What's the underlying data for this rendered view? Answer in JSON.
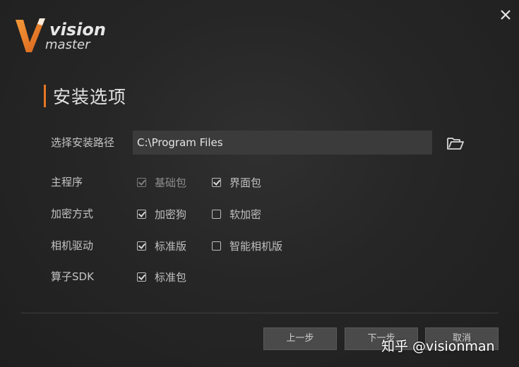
{
  "window": {
    "close_icon": "close-icon"
  },
  "logo": {
    "line1": "vision",
    "line2": "master",
    "accent_color": "#e87722"
  },
  "section": {
    "title": "安装选项"
  },
  "install_path": {
    "label": "选择安装路径",
    "value": "C:\\Program Files",
    "browse_icon": "folder-open-icon"
  },
  "rows": [
    {
      "label": "主程序",
      "options": [
        {
          "label": "基础包",
          "checked": true,
          "disabled": true
        },
        {
          "label": "界面包",
          "checked": true,
          "disabled": false
        }
      ]
    },
    {
      "label": "加密方式",
      "options": [
        {
          "label": "加密狗",
          "checked": true,
          "disabled": false
        },
        {
          "label": "软加密",
          "checked": false,
          "disabled": false
        }
      ]
    },
    {
      "label": "相机驱动",
      "options": [
        {
          "label": "标准版",
          "checked": true,
          "disabled": false
        },
        {
          "label": "智能相机版",
          "checked": false,
          "disabled": false
        }
      ]
    },
    {
      "label": "算子SDK",
      "options": [
        {
          "label": "标准包",
          "checked": true,
          "disabled": false
        }
      ]
    }
  ],
  "buttons": {
    "prev": "上一步",
    "next": "下一步",
    "cancel": "取消"
  },
  "watermark": "知乎 @visionman"
}
